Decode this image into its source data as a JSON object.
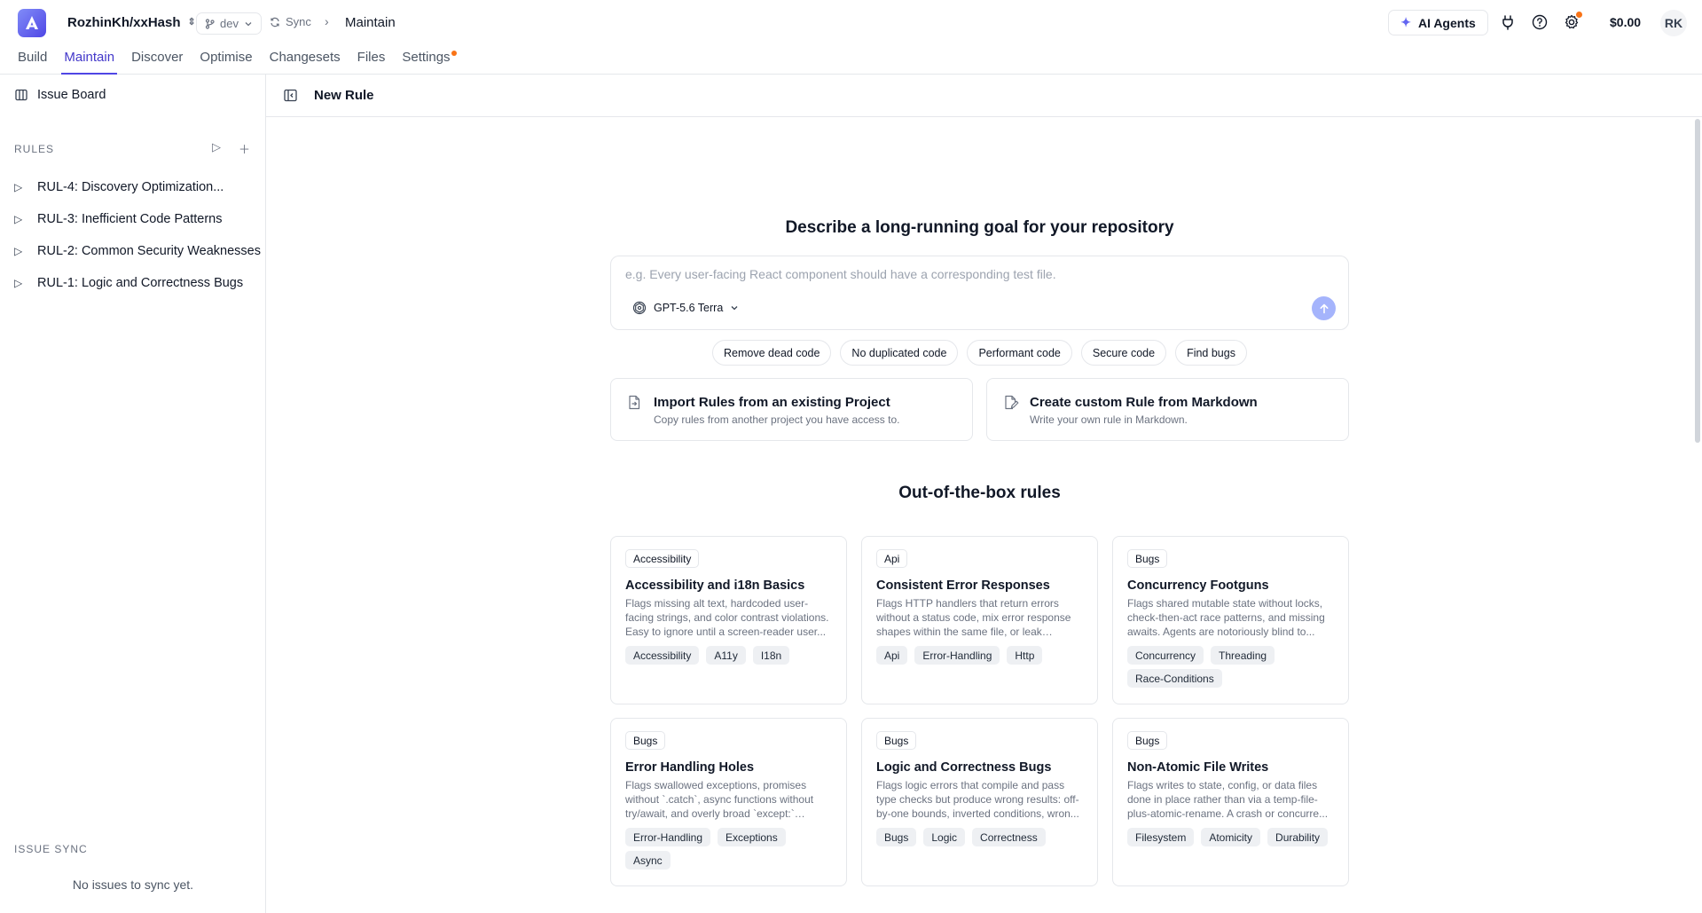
{
  "header": {
    "repo": "RozhinKh/xxHash",
    "branch": "dev",
    "sync_label": "Sync",
    "crumb": "Maintain",
    "ai_agents_label": "AI Agents",
    "balance": "$0.00",
    "avatar_initials": "RK"
  },
  "tabs": [
    {
      "label": "Build"
    },
    {
      "label": "Maintain"
    },
    {
      "label": "Discover"
    },
    {
      "label": "Optimise"
    },
    {
      "label": "Changesets"
    },
    {
      "label": "Files"
    },
    {
      "label": "Settings"
    }
  ],
  "sidebar": {
    "issue_board": "Issue Board",
    "rules_heading": "RULES",
    "rules": [
      {
        "label": "RUL-4: Discovery Optimization..."
      },
      {
        "label": "RUL-3: Inefficient Code Patterns"
      },
      {
        "label": "RUL-2: Common Security Weaknesses"
      },
      {
        "label": "RUL-1: Logic and Correctness Bugs"
      }
    ],
    "issue_sync_heading": "ISSUE SYNC",
    "no_issues": "No issues to sync yet."
  },
  "main": {
    "title": "New Rule",
    "goal_title": "Describe a long-running goal for your repository",
    "goal_placeholder": "e.g. Every user-facing React component should have a corresponding test file.",
    "model": "GPT-5.6 Terra",
    "chips": [
      "Remove dead code",
      "No duplicated code",
      "Performant code",
      "Secure code",
      "Find bugs"
    ],
    "import_card": {
      "title": "Import Rules from an existing Project",
      "desc": "Copy rules from another project you have access to."
    },
    "custom_card": {
      "title": "Create custom Rule from Markdown",
      "desc": "Write your own rule in Markdown."
    },
    "ootb_title": "Out-of-the-box rules",
    "rule_cards": [
      {
        "category": "Accessibility",
        "title": "Accessibility and i18n Basics",
        "desc": "Flags missing alt text, hardcoded user-facing strings, and color contrast violations. Easy to ignore until a screen-reader user...",
        "tags": [
          "Accessibility",
          "A11y",
          "I18n"
        ]
      },
      {
        "category": "Api",
        "title": "Consistent Error Responses",
        "desc": "Flags HTTP handlers that return errors without a status code, mix error response shapes within the same file, or leak interna...",
        "tags": [
          "Api",
          "Error-Handling",
          "Http"
        ]
      },
      {
        "category": "Bugs",
        "title": "Concurrency Footguns",
        "desc": "Flags shared mutable state without locks, check-then-act race patterns, and missing awaits. Agents are notoriously blind to...",
        "tags": [
          "Concurrency",
          "Threading",
          "Race-Conditions"
        ]
      },
      {
        "category": "Bugs",
        "title": "Error Handling Holes",
        "desc": "Flags swallowed exceptions, promises without `.catch`, async functions without try/await, and overly broad `except:` clause...",
        "tags": [
          "Error-Handling",
          "Exceptions",
          "Async"
        ]
      },
      {
        "category": "Bugs",
        "title": "Logic and Correctness Bugs",
        "desc": "Flags logic errors that compile and pass type checks but produce wrong results: off-by-one bounds, inverted conditions, wron...",
        "tags": [
          "Bugs",
          "Logic",
          "Correctness"
        ]
      },
      {
        "category": "Bugs",
        "title": "Non-Atomic File Writes",
        "desc": "Flags writes to state, config, or data files done in place rather than via a temp-file-plus-atomic-rename. A crash or concurre...",
        "tags": [
          "Filesystem",
          "Atomicity",
          "Durability"
        ]
      }
    ]
  },
  "colors": {
    "accent": "#4f46e5",
    "notification": "#f97316",
    "send_button": "#a5b4fc"
  }
}
